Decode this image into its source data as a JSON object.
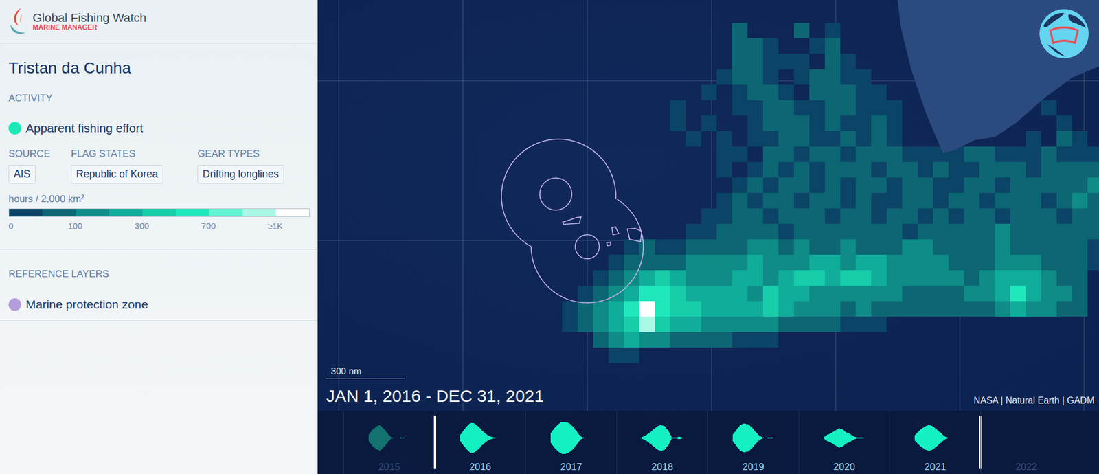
{
  "app": {
    "name": "Global Fishing Watch",
    "product": "MARINE MANAGER"
  },
  "area": {
    "title": "Tristan da Cunha"
  },
  "activity": {
    "heading": "ACTIVITY",
    "layer": {
      "label": "Apparent fishing effort",
      "color": "#1de9b6"
    },
    "filters": [
      {
        "label": "SOURCE",
        "values": [
          "AIS"
        ]
      },
      {
        "label": "FLAG STATES",
        "values": [
          "Republic of Korea"
        ]
      },
      {
        "label": "GEAR TYPES",
        "values": [
          "Drifting longlines"
        ]
      }
    ],
    "legend": {
      "unit": "hours / 2,000 km²",
      "bins": [
        "#0b4466",
        "#0d6673",
        "#0f8c87",
        "#10ad9a",
        "#17cdaa",
        "#1fe8bc",
        "#63f2d2",
        "#aaf8e6",
        "#ffffff"
      ],
      "ticks": [
        {
          "label": "0",
          "bin": 0
        },
        {
          "label": "100",
          "bin": 2
        },
        {
          "label": "300",
          "bin": 4
        },
        {
          "label": "700",
          "bin": 6
        },
        {
          "label": "≥1K",
          "bin": 8
        }
      ]
    }
  },
  "reference": {
    "heading": "REFERENCE LAYERS",
    "layers": [
      {
        "label": "Marine protection zone",
        "color": "#b39ddb"
      }
    ]
  },
  "map": {
    "date_range": "JAN 1, 2016 - DEC 31, 2021",
    "scale": "300 nm",
    "attribution": "NASA | Natural Earth | GADM",
    "heatmap": {
      "rows": [
        "000000000000200020100000000000000000",
        "000000000000221001200000000000000000",
        "000000000000221110210000000000000000",
        "000000000001221012211000000000000000",
        "000000000010122102221100000000000000",
        "000000001000112211221110000000001000",
        "000000001010012221211210000000000100",
        "000000000101011221121210000000010210",
        "000000000001102212212221111221112111",
        "000000000001012121222122121122212222",
        "000000000000121221212212211221222223",
        "000000000001212212212112212212221232",
        "000000000011221222122122121221222122",
        "000000000112222122222221222223222222",
        "000001211222233232232223322223222221",
        "000012222333343334434433332223332221",
        "000123454333443455455433333234443220",
        "001234665444435443333332222334643320",
        "012346965544445433323222222223433220",
        "012345854433333222211100000000000000",
        "000234332222111000000000000000000000",
        "000011000000000000000000000000000000"
      ]
    }
  },
  "timeline": {
    "years": [
      {
        "label": "2015",
        "selected": false,
        "values": [
          0.2,
          0.5,
          0.7,
          0.8,
          0.6,
          0.3,
          0.05,
          0,
          0,
          0.05,
          0,
          0
        ]
      },
      {
        "label": "2016",
        "selected": true,
        "values": [
          0.15,
          0.45,
          0.75,
          0.95,
          0.9,
          0.7,
          0.45,
          0.25,
          0.1,
          0.05,
          0,
          0
        ]
      },
      {
        "label": "2017",
        "selected": true,
        "values": [
          0.3,
          0.6,
          0.85,
          1,
          1,
          0.9,
          0.7,
          0.4,
          0.1,
          0,
          0,
          0
        ]
      },
      {
        "label": "2018",
        "selected": true,
        "values": [
          0.05,
          0.15,
          0.3,
          0.5,
          0.7,
          0.8,
          0.75,
          0.5,
          0.05,
          0.02,
          0.08,
          0
        ]
      },
      {
        "label": "2019",
        "selected": true,
        "values": [
          0.2,
          0.5,
          0.8,
          0.9,
          0.85,
          0.7,
          0.4,
          0.15,
          0.02,
          0,
          0.05,
          0
        ]
      },
      {
        "label": "2020",
        "selected": true,
        "values": [
          0.05,
          0.2,
          0.3,
          0.45,
          0.6,
          0.55,
          0.35,
          0.25,
          0.1,
          0.02,
          0.05,
          0
        ]
      },
      {
        "label": "2021",
        "selected": true,
        "values": [
          0.15,
          0.4,
          0.6,
          0.75,
          0.8,
          0.7,
          0.5,
          0.3,
          0.1,
          0,
          0,
          0
        ]
      },
      {
        "label": "2022",
        "selected": false,
        "values": [
          0,
          0,
          0,
          0,
          0,
          0,
          0,
          0,
          0,
          0,
          0,
          0
        ]
      }
    ]
  }
}
